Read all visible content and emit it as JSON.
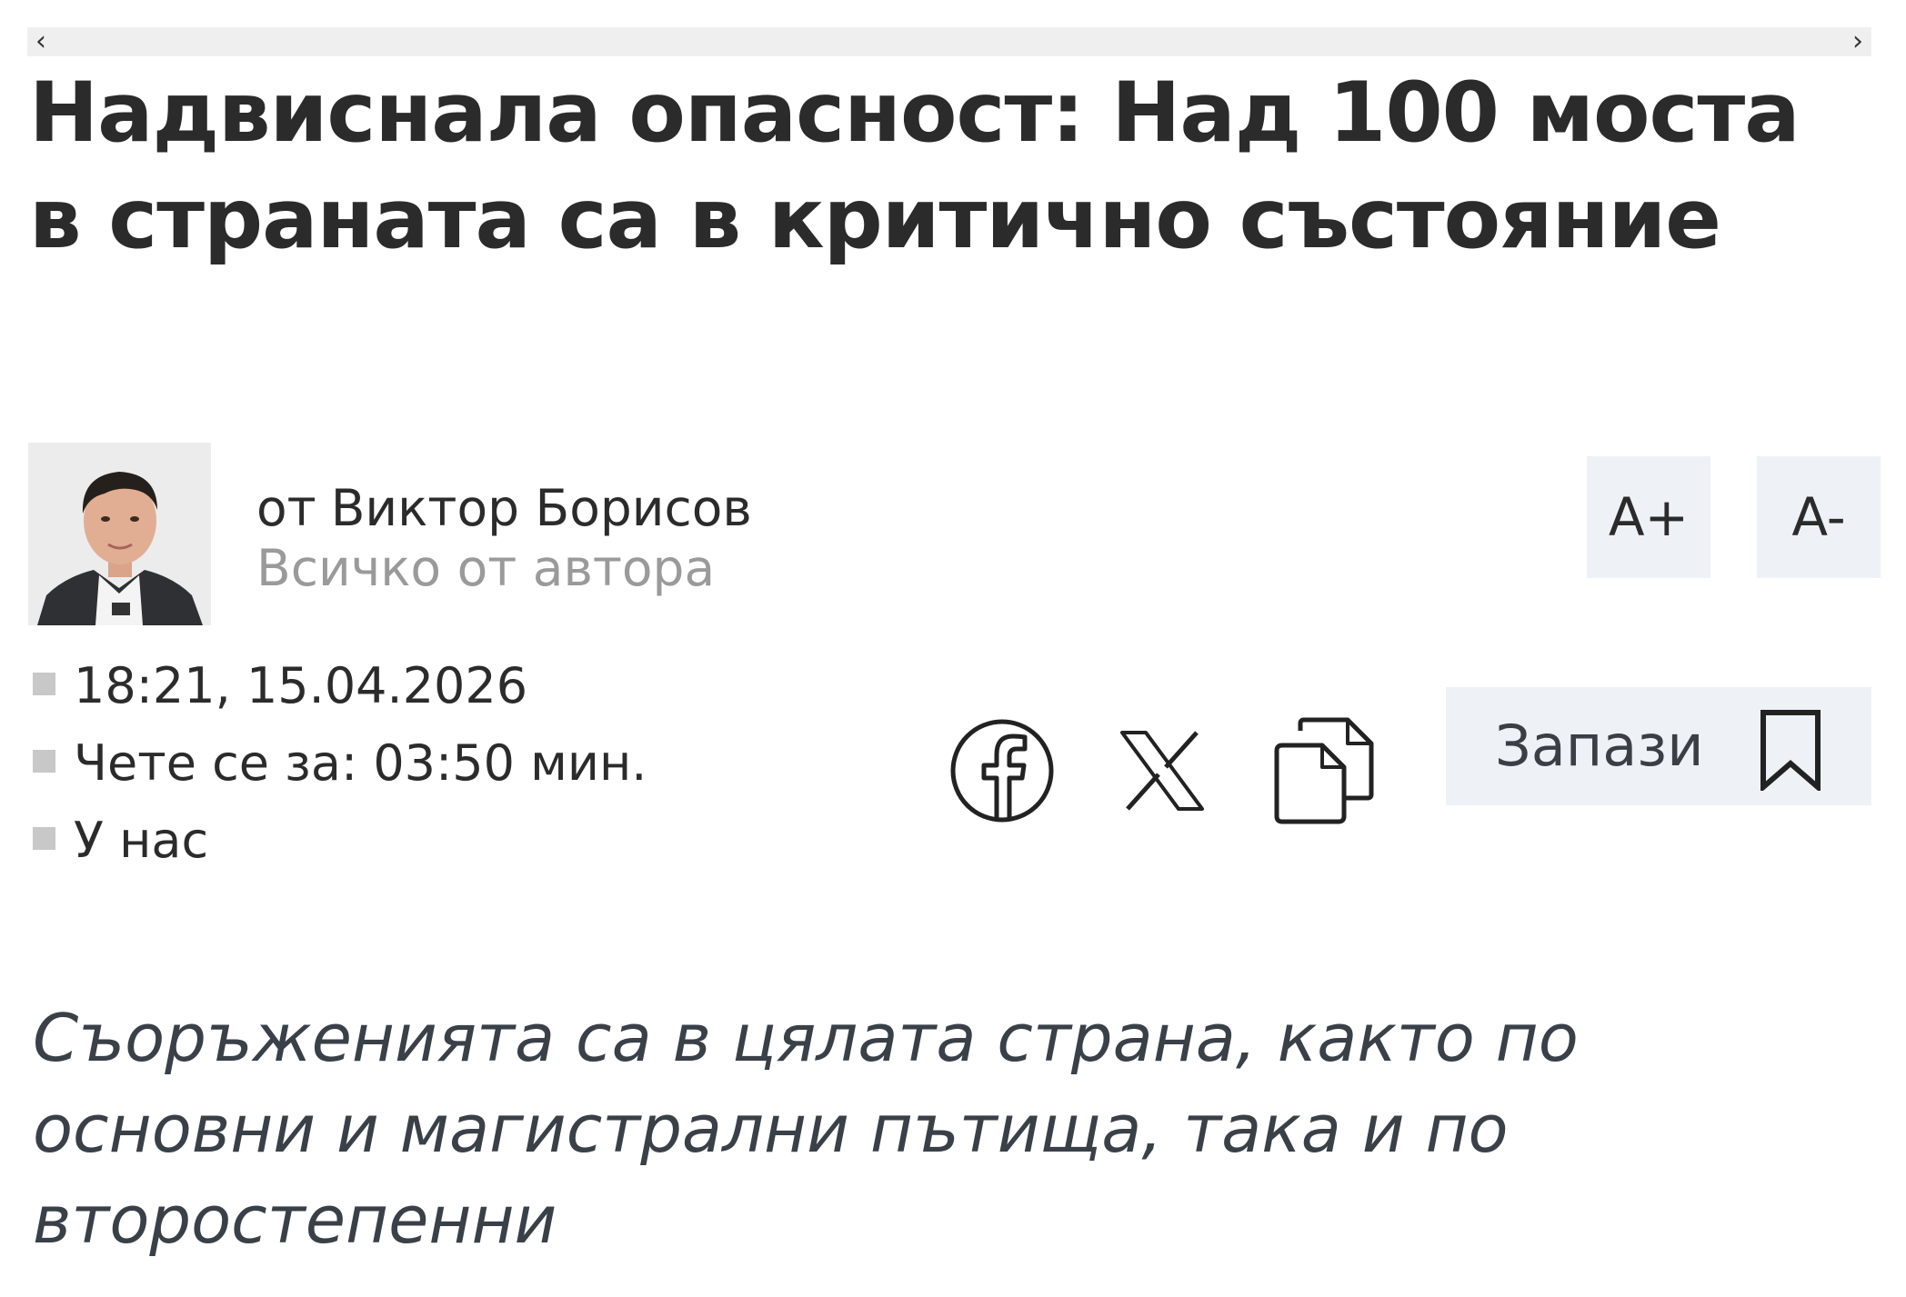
{
  "scroller": {
    "left_arrow": "‹",
    "right_arrow": "›"
  },
  "article": {
    "title": "Надвиснала опасност: Над 100 моста в страната са в критично състояние",
    "lead": "Съоръженията са в цялата страна, както по основни и магистрални пътища, така и по второстепенни"
  },
  "author": {
    "prefix": "от",
    "name": "Виктор Борисов",
    "all_link": "Всичко от автора"
  },
  "font_controls": {
    "increase": "A+",
    "decrease": "A-"
  },
  "meta": {
    "datetime": "18:21, 15.04.2026",
    "read_time": "Чете се за: 03:50 мин.",
    "category": "У нас"
  },
  "share": {
    "icons": [
      "facebook-icon",
      "x-icon",
      "copy-icon"
    ]
  },
  "save": {
    "label": "Запази",
    "icon": "bookmark-icon"
  },
  "colors": {
    "text": "#2b2b2b",
    "muted": "#9a9a9a",
    "button_bg": "#eef1f5",
    "lead_text": "#3a4048",
    "bullet": "#c8c8c8"
  }
}
